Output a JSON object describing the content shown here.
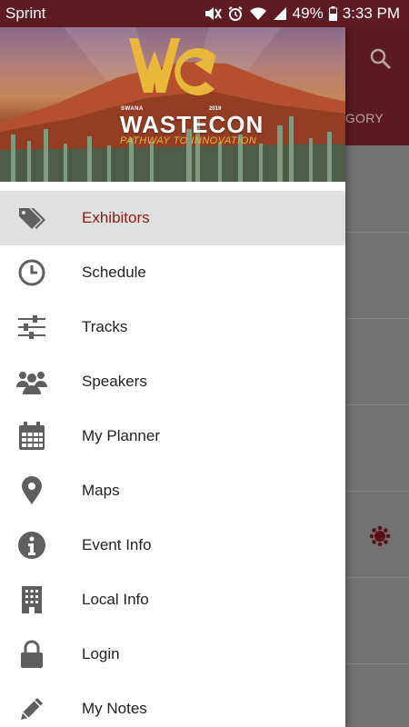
{
  "status_bar": {
    "carrier": "Sprint",
    "battery": "49%",
    "time": "3:33 PM"
  },
  "background_app": {
    "tab_fragment": "EGORY",
    "search_icon": "search-icon",
    "badge_icon": "flower-badge-icon"
  },
  "drawer": {
    "banner": {
      "brand": "WASTECON",
      "small_label": "SWANA",
      "year": "2019",
      "tagline": "PATHWAY TO INNOVATION"
    },
    "menu": [
      {
        "label": "Exhibitors",
        "icon": "tags-icon",
        "active": true
      },
      {
        "label": "Schedule",
        "icon": "clock-icon",
        "active": false
      },
      {
        "label": "Tracks",
        "icon": "sliders-icon",
        "active": false
      },
      {
        "label": "Speakers",
        "icon": "users-icon",
        "active": false
      },
      {
        "label": "My Planner",
        "icon": "calendar-icon",
        "active": false
      },
      {
        "label": "Maps",
        "icon": "map-pin-icon",
        "active": false
      },
      {
        "label": "Event Info",
        "icon": "info-icon",
        "active": false
      },
      {
        "label": "Local Info",
        "icon": "building-icon",
        "active": false
      },
      {
        "label": "Login",
        "icon": "lock-icon",
        "active": false
      },
      {
        "label": "My Notes",
        "icon": "pencil-icon",
        "active": false
      }
    ]
  },
  "colors": {
    "status_bar_bg": "#5e1b22",
    "toolbar_bg": "#5a1a20",
    "active_label": "#8b1a1a",
    "active_row_bg": "#e0e0e0",
    "icon_gray": "#5f5f5f",
    "logo_gold": "#e9b73a"
  }
}
